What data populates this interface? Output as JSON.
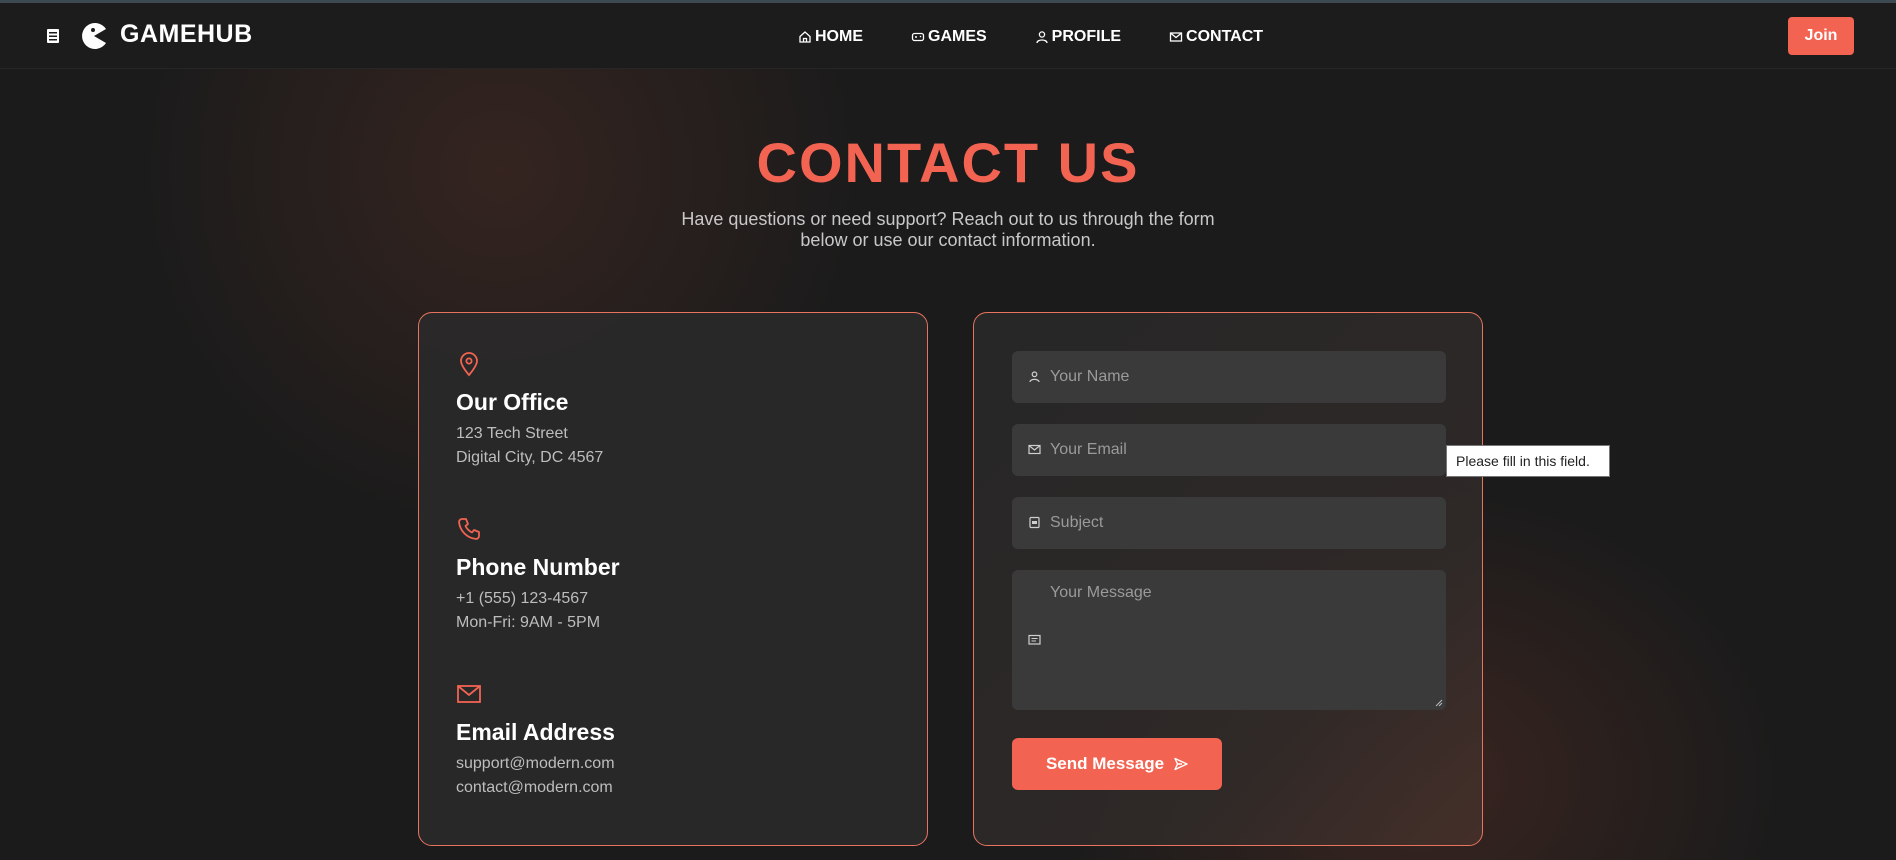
{
  "header": {
    "brand": "GAMEHUB",
    "nav": [
      {
        "label": "HOME",
        "icon": "home-icon"
      },
      {
        "label": "GAMES",
        "icon": "gamepad-icon"
      },
      {
        "label": "PROFILE",
        "icon": "user-icon"
      },
      {
        "label": "CONTACT",
        "icon": "mail-icon"
      }
    ],
    "join_label": "Join"
  },
  "page": {
    "title": "CONTACT US",
    "subtitle": "Have questions or need support? Reach out to us through the form below or use our contact information."
  },
  "info": {
    "office": {
      "title": "Our Office",
      "lines": [
        "123 Tech Street",
        "Digital City, DC 4567"
      ]
    },
    "phone": {
      "title": "Phone Number",
      "lines": [
        "+1 (555) 123-4567",
        "Mon-Fri: 9AM - 5PM"
      ]
    },
    "email": {
      "title": "Email Address",
      "lines": [
        "support@modern.com",
        "contact@modern.com"
      ]
    }
  },
  "form": {
    "name_placeholder": "Your Name",
    "email_placeholder": "Your Email",
    "subject_placeholder": "Subject",
    "message_placeholder": "Your Message",
    "send_label": "Send Message",
    "validation_tooltip": "Please fill in this field."
  },
  "colors": {
    "accent": "#f26352",
    "background": "#1c1c1c",
    "card_border": "#e8735f"
  }
}
